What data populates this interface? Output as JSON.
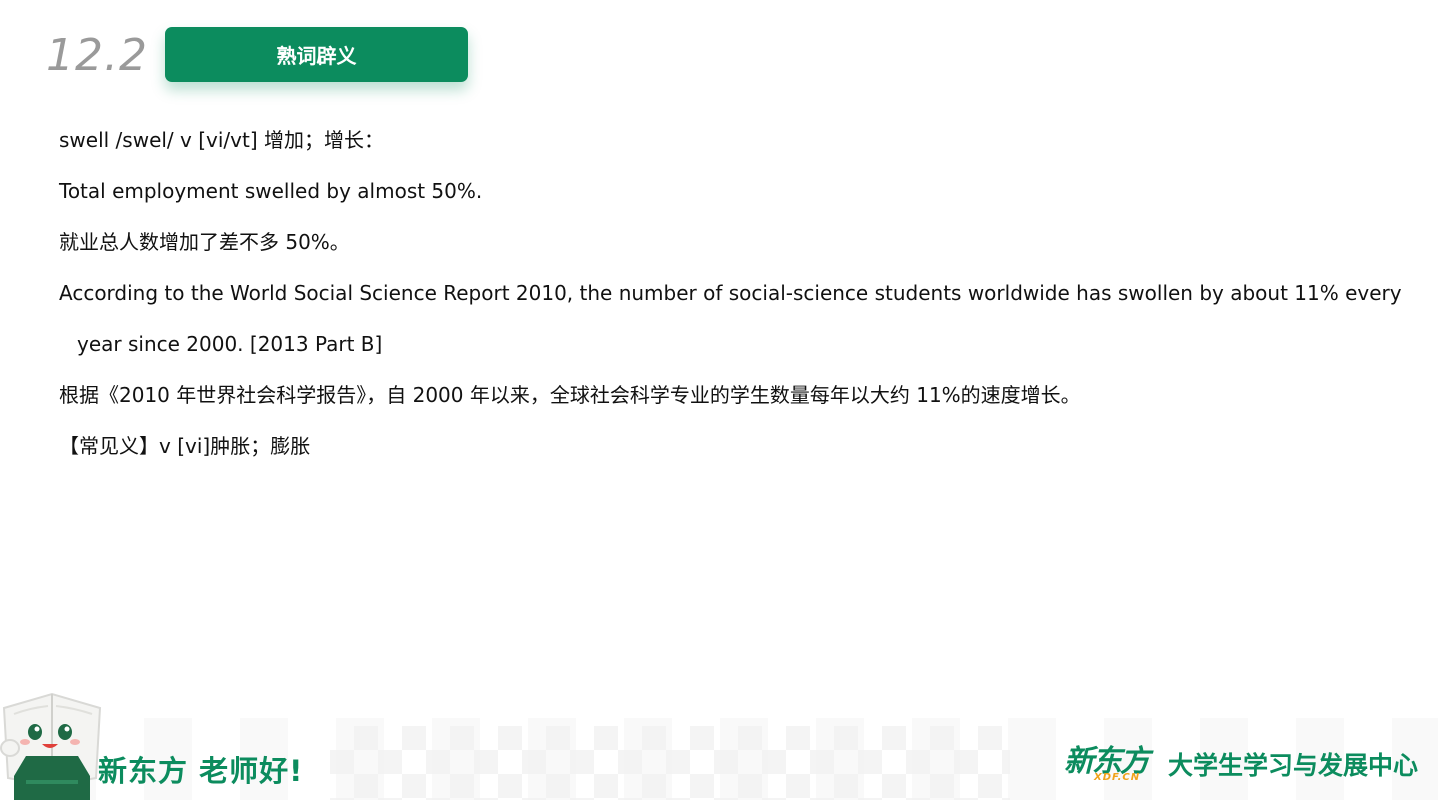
{
  "header": {
    "slide_number": "12.2",
    "title": "熟词辟义"
  },
  "content": {
    "lines": [
      "swell /swel/ v [vi/vt] 增加；增长：",
      "Total employment swelled by almost 50%.",
      "就业总人数增加了差不多 50%。",
      "According to the World Social Science Report 2010, the number of social-science students worldwide has swollen by about 11% every",
      "year since 2000. [2013 Part B]",
      "根据《2010 年世界社会科学报告》，自 2000 年以来，全球社会科学专业的学生数量每年以大约 11%的速度增长。",
      "【常见义】v [vi]肿胀；膨胀"
    ]
  },
  "footer": {
    "slogan": "新东方 老师好!",
    "logo_text": "新东方",
    "logo_sub": "XDF.CN",
    "center_name": "大学生学习与发展中心"
  },
  "colors": {
    "brand_green": "#0c8c5e",
    "logo_orange": "#f0a21a",
    "slide_number_gray": "#9a9a9a"
  }
}
